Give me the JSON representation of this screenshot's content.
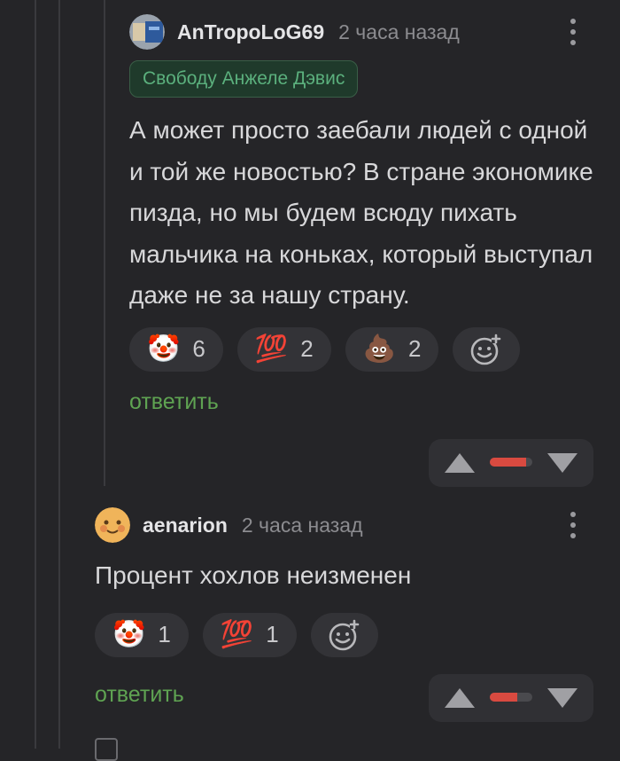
{
  "comments": [
    {
      "username": "AnTropoLoG69",
      "time": "2 часа назад",
      "badge": "Свободу Анжеле Дэвис",
      "text": "А может просто заебали людей с одной и той же новостью? В стране экономике пизда, но мы будем всюду пихать мальчика на коньках, который выступал даже не за нашу страну.",
      "reactions": [
        {
          "emoji": "🤡",
          "count": "6"
        },
        {
          "emoji": "💯",
          "count": "2"
        },
        {
          "emoji": "💩",
          "count": "2"
        }
      ],
      "add_reaction_icon": "smiley-plus-icon",
      "reply_label": "ответить",
      "rating_fill": 0.85
    },
    {
      "username": "aenarion",
      "time": "2 часа назад",
      "text": "Процент хохлов неизменен",
      "reactions": [
        {
          "emoji": "🤡",
          "count": "1"
        },
        {
          "emoji": "💯",
          "count": "1"
        }
      ],
      "add_reaction_icon": "smiley-plus-icon",
      "reply_label": "ответить",
      "rating_fill": 0.65
    }
  ],
  "colors": {
    "background": "#252528",
    "accent_green": "#5fa352",
    "vote_red": "#d94a40",
    "badge_bg": "#1f3a2b"
  }
}
